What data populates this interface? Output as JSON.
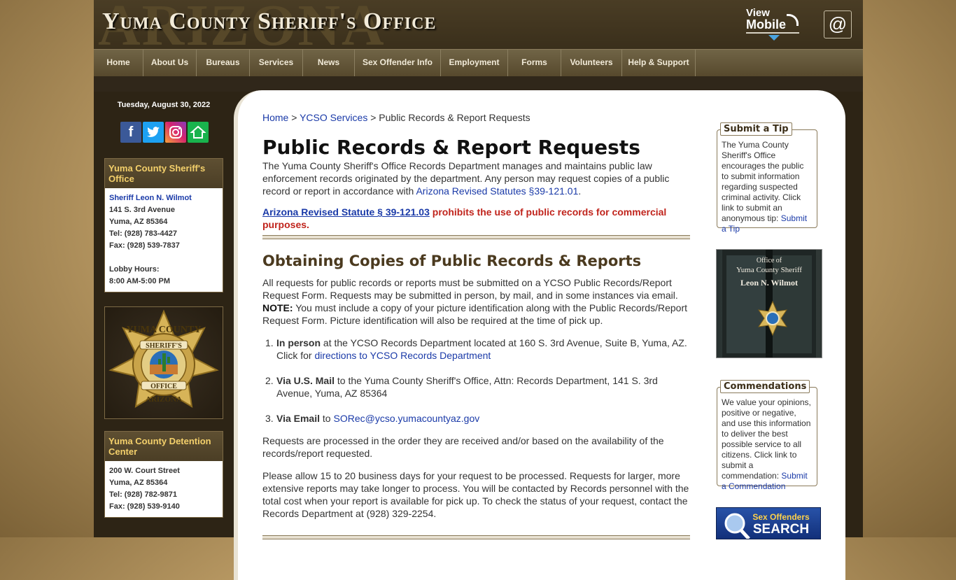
{
  "header": {
    "background_word": "ARIZONA",
    "site_title": "Yuma County Sheriff's Office",
    "view_mobile_line1": "View",
    "view_mobile_line2": "Mobile",
    "email_symbol": "@"
  },
  "nav": {
    "items": [
      "Home",
      "About Us",
      "Bureaus",
      "Services",
      "News",
      "Sex Offender Info",
      "Employment",
      "Forms",
      "Volunteers",
      "Help & Support"
    ]
  },
  "sidebar": {
    "date": "Tuesday, August 30, 2022",
    "social_icons": [
      "facebook-icon",
      "twitter-icon",
      "instagram-icon",
      "nextdoor-icon"
    ],
    "office_box": {
      "title": "Yuma County Sheriff's Office",
      "sheriff": "Sheriff Leon N. Wilmot",
      "address1": "141 S. 3rd Avenue",
      "address2": "Yuma, AZ 85364",
      "tel": "Tel: (928) 783-4427",
      "fax": "Fax: (928) 539-7837",
      "lobby_label": "Lobby Hours:",
      "lobby_hours": "8:00 AM-5:00 PM"
    },
    "badge": {
      "top_text": "YUMA COUNTY",
      "ribbon_top": "SHERIFF'S",
      "ribbon_bottom": "OFFICE",
      "bottom_text": "ARIZONA"
    },
    "detention_box": {
      "title": "Yuma County Detention Center",
      "address1": "200 W. Court Street",
      "address2": "Yuma, AZ 85364",
      "tel": "Tel: (928) 782-9871",
      "fax": "Fax: (928) 539-9140"
    }
  },
  "breadcrumb": {
    "home": "Home",
    "sep": ">",
    "services": "YCSO Services",
    "current": "Public Records & Report Requests"
  },
  "main": {
    "title": "Public Records & Report Requests",
    "intro": "The Yuma County Sheriff's Office Records Department manages and maintains public law enforcement records originated by the department. Any person may request copies of a public record or report in accordance with ",
    "intro_link": "Arizona Revised Statutes §39-121.01",
    "intro_end": ".",
    "ars_link": "Arizona Revised Statute § 39-121.03",
    "ars_warning": " prohibits the use of public records for commercial purposes.",
    "section_title": "Obtaining Copies of Public Records & Reports",
    "section_p1": "All requests for public records or reports must be submitted on a YCSO Public Records/Report Request Form. Requests may be submitted in person, by mail, and in some instances via email.",
    "note_label": "NOTE:",
    "note_text": " You must include a copy of your picture identification along with the Public Records/Report Request Form. Picture identification will also be required at the time of pick up.",
    "list": [
      {
        "num": "1.",
        "bold": "In person",
        "text": " at the YCSO Records Department located at 160 S. 3rd Avenue, Suite B, Yuma, AZ. Click for ",
        "link": "directions to YCSO Records Department"
      },
      {
        "num": "2.",
        "bold": "Via U.S. Mail",
        "text": " to the Yuma County Sheriff's Office, Attn: Records Department, 141 S. 3rd Avenue, Yuma, AZ 85364"
      },
      {
        "num": "3.",
        "bold": "Via Email",
        "text": " to ",
        "link": "SORec@ycso.yumacountyaz.gov"
      }
    ],
    "para_order": "Requests are processed in the order they are received and/or based on the availability of the records/report requested.",
    "para_allow": "Please allow 15 to 20 business days for your request to be processed. Requests for larger, more extensive reports may take longer to process. You will be contacted by Records personnel with the total cost when your report is available for pick up. To check the status of your request, contact the Records Department at (928) 329-2254."
  },
  "right": {
    "tip": {
      "title": "Submit a Tip",
      "text": "The Yuma County Sheriff's Office encourages the public to submit information regarding suspected criminal activity. Click link to submit an anonymous tip: ",
      "link": "Submit a Tip"
    },
    "photo": {
      "line1": "Office of",
      "line2": "Yuma County Sheriff",
      "line3": "Leon N. Wilmot"
    },
    "commend": {
      "title": "Commendations",
      "text": "We value your opinions, positive or negative, and use this information to deliver the best possible service to all citizens. Click link to submit a commendation: ",
      "link": "Submit a Commendation"
    },
    "sex_offenders": {
      "line1": "Sex Offenders",
      "line2": "SEARCH"
    }
  },
  "colors": {
    "header_bg": "#3a2f1b",
    "nav_bg": "#605235",
    "sidebar_title": "#f4d06b",
    "link": "#1a3aa8",
    "warning": "#c0241c",
    "section_title": "#4b3a1f"
  }
}
